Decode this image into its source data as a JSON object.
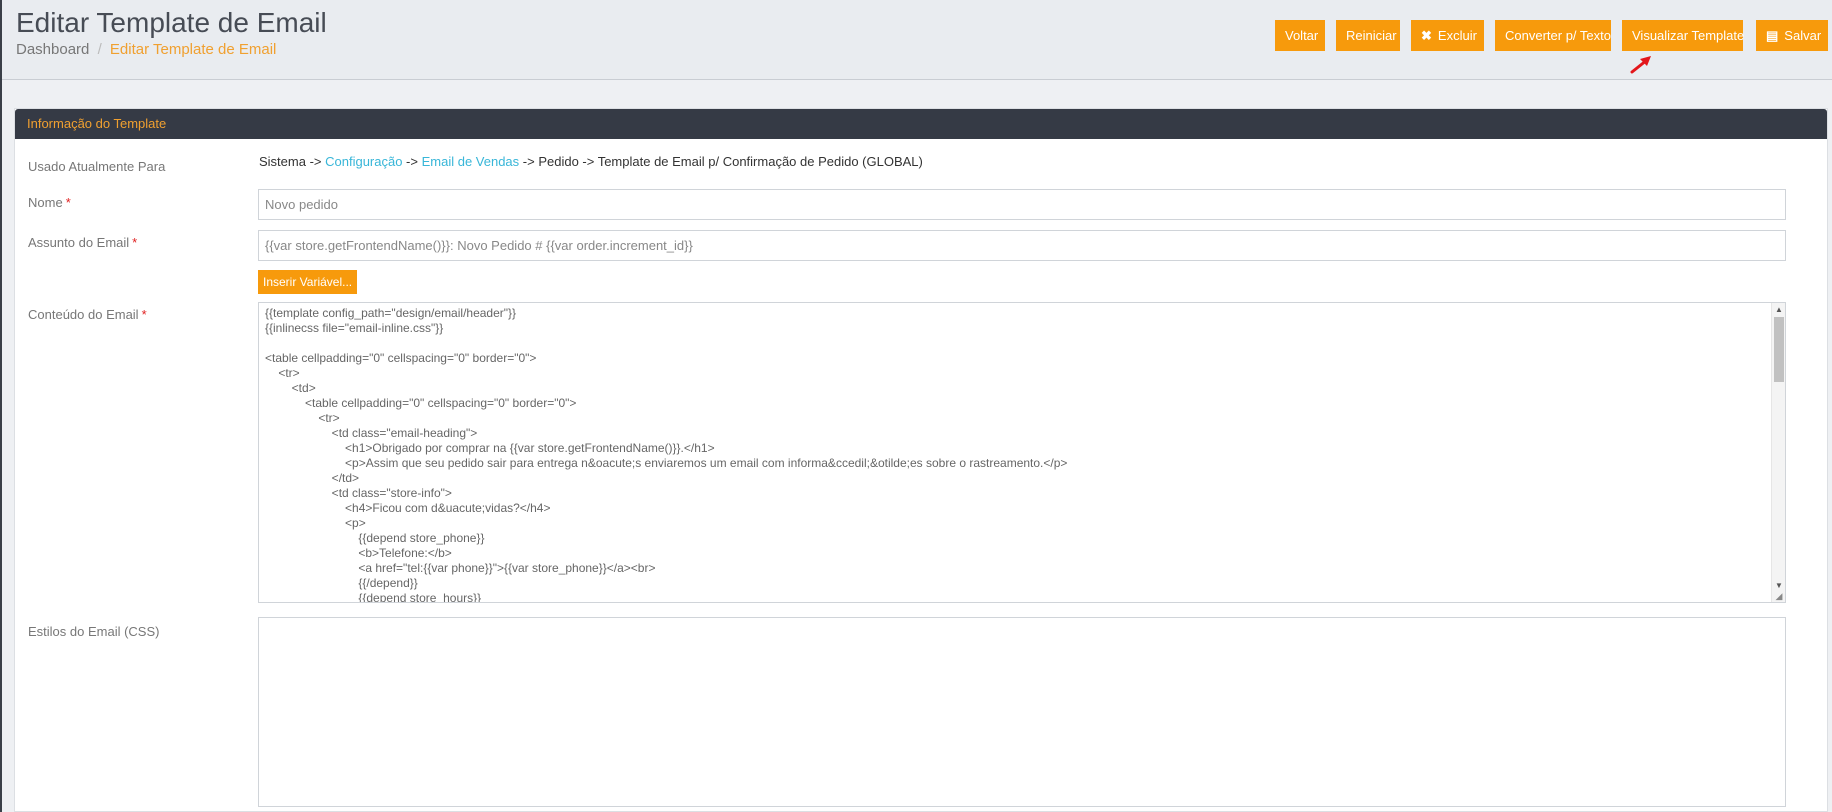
{
  "header": {
    "title": "Editar Template de Email",
    "breadcrumb": {
      "home": "Dashboard",
      "separator": "/",
      "current": "Editar Template de Email"
    }
  },
  "toolbar": {
    "back_label": "Voltar",
    "reset_label": "Reiniciar",
    "delete_label": "Excluir",
    "convert_label": "Converter p/ Texto",
    "preview_label": "Visualizar Template",
    "save_label": "Salvar"
  },
  "panel": {
    "title": "Informação do Template",
    "currently_used": {
      "label": "Usado Atualmente Para",
      "part1": "Sistema -> ",
      "link1": "Configuração",
      "part2": " -> ",
      "link2": "Email de Vendas",
      "part3": " -> Pedido  -> Template de Email p/ Confirmação de Pedido  (GLOBAL)"
    },
    "name": {
      "label": "Nome",
      "required": "*",
      "value": "Novo pedido"
    },
    "subject": {
      "label": "Assunto do Email",
      "required": "*",
      "value": "{{var store.getFrontendName()}}: Novo Pedido # {{var order.increment_id}}"
    },
    "insert_variable_label": "Inserir Variável...",
    "content": {
      "label": "Conteúdo do Email",
      "required": "*",
      "code": "{{template config_path=\"design/email/header\"}}\n{{inlinecss file=\"email-inline.css\"}}\n\n<table cellpadding=\"0\" cellspacing=\"0\" border=\"0\">\n    <tr>\n        <td>\n            <table cellpadding=\"0\" cellspacing=\"0\" border=\"0\">\n                <tr>\n                    <td class=\"email-heading\">\n                        <h1>Obrigado por comprar na {{var store.getFrontendName()}}.</h1>\n                        <p>Assim que seu pedido sair para entrega n&oacute;s enviaremos um email com informa&ccedil;&otilde;es sobre o rastreamento.</p>\n                    </td>\n                    <td class=\"store-info\">\n                        <h4>Ficou com d&uacute;vidas?</h4>\n                        <p>\n                            {{depend store_phone}}\n                            <b>Telefone:</b>\n                            <a href=\"tel:{{var phone}}\">{{var store_phone}}</a><br>\n                            {{/depend}}\n                            {{depend store_hours}}"
    },
    "styles": {
      "label": "Estilos do Email (CSS)",
      "value": ""
    }
  },
  "colors": {
    "accent": "#f79a0c",
    "panel_header": "#353a45",
    "link": "#38b6d8",
    "required": "#e02020"
  }
}
